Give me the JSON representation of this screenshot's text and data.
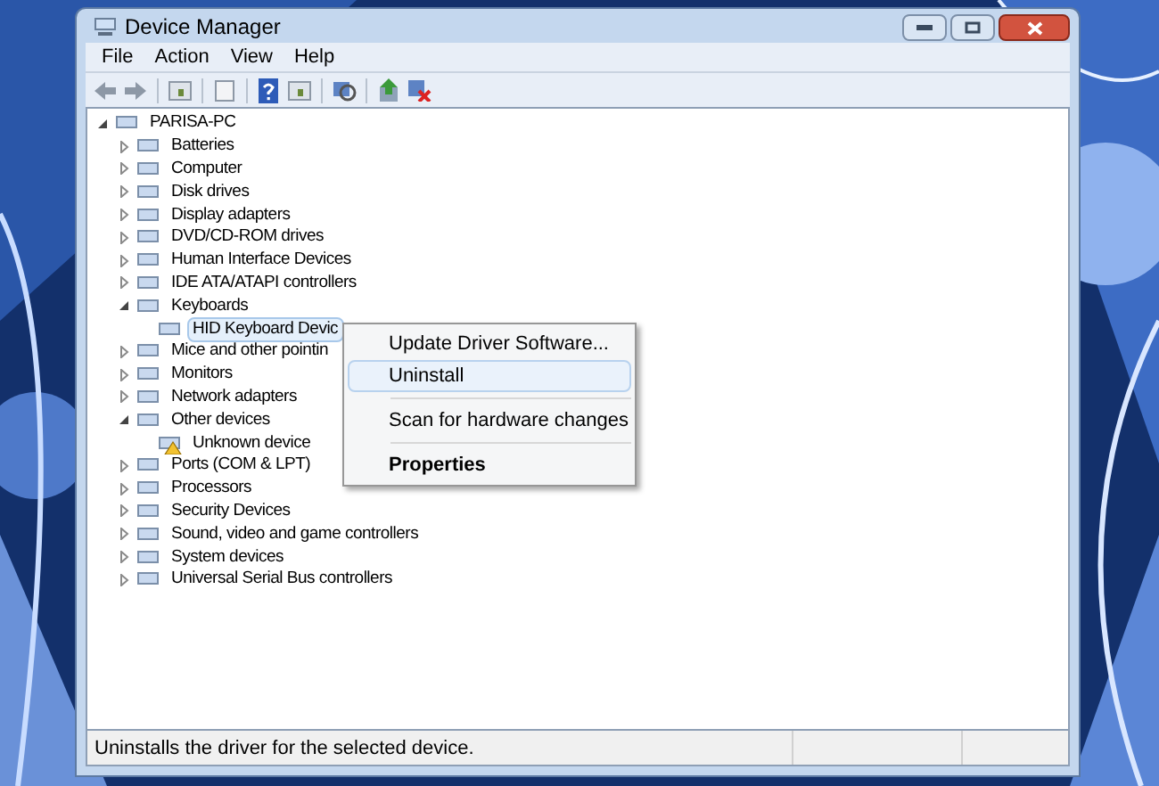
{
  "window": {
    "title": "Device Manager"
  },
  "menu": [
    "File",
    "Action",
    "View",
    "Help"
  ],
  "tree": [
    {
      "label": "PARISA-PC",
      "expanded": true,
      "selected": false,
      "children": [
        {
          "label": "Batteries",
          "expanded": false,
          "selected": false
        },
        {
          "label": "Computer",
          "expanded": false,
          "selected": false
        },
        {
          "label": "Disk drives",
          "expanded": false,
          "selected": false
        },
        {
          "label": "Display adapters",
          "expanded": false,
          "selected": false
        },
        {
          "label": "DVD/CD-ROM drives",
          "expanded": false,
          "selected": false
        },
        {
          "label": "Human Interface Devices",
          "expanded": false,
          "selected": false
        },
        {
          "label": "IDE ATA/ATAPI controllers",
          "expanded": false,
          "selected": false
        },
        {
          "label": "Keyboards",
          "expanded": true,
          "selected": false,
          "children": [
            {
              "label": "HID Keyboard Devic",
              "selected": true,
              "warning": false
            }
          ]
        },
        {
          "label": "Mice and other pointin",
          "expanded": false,
          "selected": false
        },
        {
          "label": "Monitors",
          "expanded": false,
          "selected": false
        },
        {
          "label": "Network adapters",
          "expanded": false,
          "selected": false
        },
        {
          "label": "Other devices",
          "expanded": true,
          "selected": false,
          "children": [
            {
              "label": "Unknown device",
              "selected": false,
              "warning": true
            }
          ]
        },
        {
          "label": "Ports (COM & LPT)",
          "expanded": false,
          "selected": false
        },
        {
          "label": "Processors",
          "expanded": false,
          "selected": false
        },
        {
          "label": "Security Devices",
          "expanded": false,
          "selected": false
        },
        {
          "label": "Sound, video and game controllers",
          "expanded": false,
          "selected": false
        },
        {
          "label": "System devices",
          "expanded": false,
          "selected": false
        },
        {
          "label": "Universal Serial Bus controllers",
          "expanded": false,
          "selected": false
        }
      ]
    }
  ],
  "context_menu": [
    {
      "label": "Update Driver Software...",
      "selected": false,
      "separator_before": false,
      "default": false
    },
    {
      "label": "Uninstall",
      "selected": true,
      "separator_before": false,
      "default": false
    },
    {
      "label": "Scan for hardware changes",
      "selected": false,
      "separator_before": true,
      "default": false
    },
    {
      "label": "Properties",
      "selected": false,
      "separator_before": true,
      "default": true
    }
  ],
  "status_bar": "Uninstalls the driver for the selected device."
}
